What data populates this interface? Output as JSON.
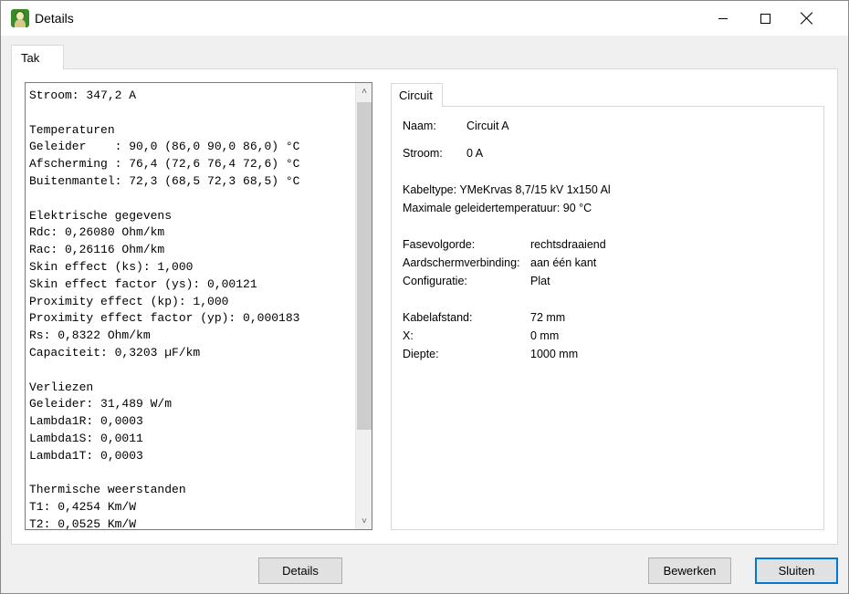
{
  "window": {
    "title": "Details"
  },
  "outer_tab": {
    "label": "Tak"
  },
  "details_text": "Stroom: 347,2 A\n\nTemperaturen\nGeleider    : 90,0 (86,0 90,0 86,0) °C\nAfscherming : 76,4 (72,6 76,4 72,6) °C\nBuitenmantel: 72,3 (68,5 72,3 68,5) °C\n\nElektrische gegevens\nRdc: 0,26080 Ohm/km\nRac: 0,26116 Ohm/km\nSkin effect (ks): 1,000\nSkin effect factor (ys): 0,00121\nProximity effect (kp): 1,000\nProximity effect factor (yp): 0,000183\nRs: 0,8322 Ohm/km\nCapaciteit: 0,3203 µF/km\n\nVerliezen\nGeleider: 31,489 W/m\nLambda1R: 0,0003\nLambda1S: 0,0011\nLambda1T: 0,0003\n\nThermische weerstanden\nT1: 0,4254 Km/W\nT2: 0,0525 Km/W",
  "circuit_tab": {
    "label": "Circuit"
  },
  "circuit": {
    "naam_label": "Naam:",
    "naam_value": "Circuit A",
    "stroom_label": "Stroom:",
    "stroom_value": "0 A",
    "kabeltype": "Kabeltype: YMeKrvas 8,7/15 kV 1x150 Al",
    "max_temp": "Maximale geleidertemperatuur:  90 °C",
    "fasevolgorde_label": "Fasevolgorde:",
    "fasevolgorde_value": "rechtsdraaiend",
    "aardscherm_label": "Aardschermverbinding:",
    "aardscherm_value": "aan één kant",
    "configuratie_label": "Configuratie:",
    "configuratie_value": "Plat",
    "kabelafstand_label": "Kabelafstand:",
    "kabelafstand_value": "72 mm",
    "x_label": "X:",
    "x_value": "0 mm",
    "diepte_label": "Diepte:",
    "diepte_value": "1000 mm"
  },
  "buttons": {
    "details": "Details",
    "bewerken": "Bewerken",
    "sluiten": "Sluiten"
  },
  "icons": {
    "app": "app-icon",
    "minimize": "minimize-icon",
    "maximize": "maximize-icon",
    "close": "close-icon",
    "scroll_up": "chevron-up-icon",
    "scroll_down": "chevron-down-icon"
  },
  "colors": {
    "accent": "#0078d7"
  }
}
